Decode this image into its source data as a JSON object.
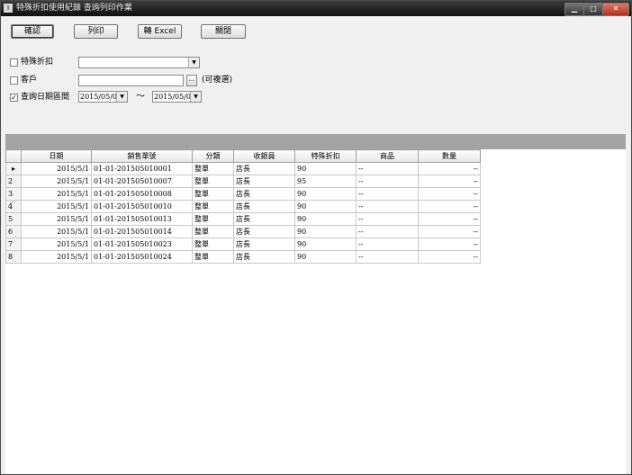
{
  "window": {
    "title": "特殊折扣使用紀錄 查詢列印作業",
    "icon_glyph": "I"
  },
  "controls": {
    "min": "▁",
    "max": "□",
    "close": "✕"
  },
  "toolbar": {
    "confirm": "確認",
    "print": "列印",
    "excel": "轉 Excel",
    "close": "關閉"
  },
  "filters": {
    "special_discount": {
      "label": "特殊折扣",
      "checked": false,
      "value": ""
    },
    "customer": {
      "label": "客戶",
      "checked": false,
      "value": "",
      "browse": "...",
      "hint": "(可複選)"
    },
    "date_range": {
      "label": "查詢日期區間",
      "checked": true,
      "from": "2015/05/01",
      "to": "2015/05/01",
      "separator": "〜"
    }
  },
  "grid": {
    "columns": [
      "日期",
      "銷售單號",
      "分類",
      "收銀員",
      "特殊折扣",
      "商品",
      "數量"
    ],
    "current_marker": "▸",
    "rows": [
      {
        "no": "",
        "date": "2015/5/1",
        "order": "01-01-201505010001",
        "category": "整單",
        "cashier": "店長",
        "discount": "90",
        "product": "--",
        "qty": "--"
      },
      {
        "no": "2",
        "date": "2015/5/1",
        "order": "01-01-201505010007",
        "category": "整單",
        "cashier": "店長",
        "discount": "95",
        "product": "--",
        "qty": "--"
      },
      {
        "no": "3",
        "date": "2015/5/1",
        "order": "01-01-201505010008",
        "category": "整單",
        "cashier": "店長",
        "discount": "90",
        "product": "--",
        "qty": "--"
      },
      {
        "no": "4",
        "date": "2015/5/1",
        "order": "01-01-201505010010",
        "category": "整單",
        "cashier": "店長",
        "discount": "90",
        "product": "--",
        "qty": "--"
      },
      {
        "no": "5",
        "date": "2015/5/1",
        "order": "01-01-201505010013",
        "category": "整單",
        "cashier": "店長",
        "discount": "90",
        "product": "--",
        "qty": "--"
      },
      {
        "no": "6",
        "date": "2015/5/1",
        "order": "01-01-201505010014",
        "category": "整單",
        "cashier": "店長",
        "discount": "90",
        "product": "--",
        "qty": "--"
      },
      {
        "no": "7",
        "date": "2015/5/1",
        "order": "01-01-201505010023",
        "category": "整單",
        "cashier": "店長",
        "discount": "90",
        "product": "--",
        "qty": "--"
      },
      {
        "no": "8",
        "date": "2015/5/1",
        "order": "01-01-201505010024",
        "category": "整單",
        "cashier": "店長",
        "discount": "90",
        "product": "--",
        "qty": "--"
      }
    ]
  }
}
